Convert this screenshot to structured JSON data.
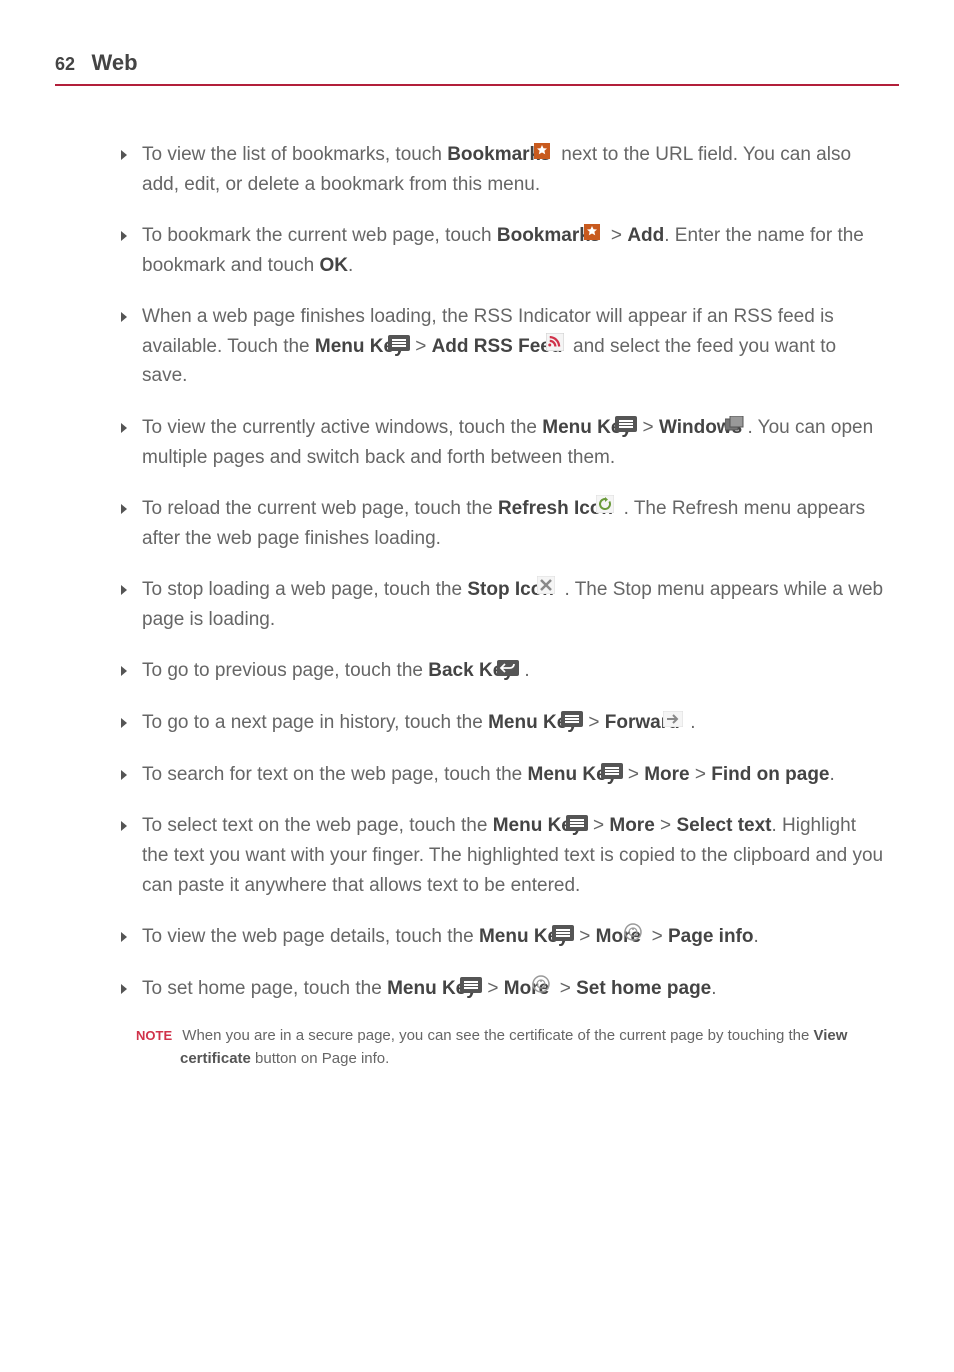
{
  "header": {
    "page_number": "62",
    "title": "Web"
  },
  "items": [
    {
      "parts": [
        {
          "t": "text",
          "v": "To view the list of bookmarks, touch "
        },
        {
          "t": "bold",
          "v": "Bookmarks"
        },
        {
          "t": "text",
          "v": " "
        },
        {
          "t": "icon",
          "v": "bookmark-star"
        },
        {
          "t": "text",
          "v": "  next to the URL field. You can also add, edit, or delete a bookmark from this menu."
        }
      ]
    },
    {
      "parts": [
        {
          "t": "text",
          "v": "To bookmark the current web page, touch "
        },
        {
          "t": "bold",
          "v": "Bookmarks"
        },
        {
          "t": "text",
          "v": " "
        },
        {
          "t": "icon",
          "v": "bookmark-star"
        },
        {
          "t": "text",
          "v": "  > "
        },
        {
          "t": "bold",
          "v": "Add"
        },
        {
          "t": "text",
          "v": ". Enter the name for the bookmark and touch "
        },
        {
          "t": "bold",
          "v": "OK"
        },
        {
          "t": "text",
          "v": "."
        }
      ]
    },
    {
      "parts": [
        {
          "t": "text",
          "v": "When a web page finishes loading, the RSS Indicator will appear if an RSS feed is available. Touch the "
        },
        {
          "t": "bold",
          "v": "Menu Key"
        },
        {
          "t": "text",
          "v": " "
        },
        {
          "t": "icon",
          "v": "menu-key"
        },
        {
          "t": "text",
          "v": " > "
        },
        {
          "t": "bold",
          "v": "Add RSS Feed"
        },
        {
          "t": "text",
          "v": " "
        },
        {
          "t": "icon",
          "v": "rss-feed"
        },
        {
          "t": "text",
          "v": " and select the feed you want to save."
        }
      ]
    },
    {
      "parts": [
        {
          "t": "text",
          "v": "To view the currently active windows, touch the "
        },
        {
          "t": "bold",
          "v": "Menu Key"
        },
        {
          "t": "text",
          "v": " "
        },
        {
          "t": "icon",
          "v": "menu-key"
        },
        {
          "t": "text",
          "v": " > "
        },
        {
          "t": "bold",
          "v": "Windows"
        },
        {
          "t": "text",
          "v": " "
        },
        {
          "t": "icon",
          "v": "windows"
        },
        {
          "t": "text",
          "v": ". You can open multiple pages and switch back and forth between them."
        }
      ]
    },
    {
      "parts": [
        {
          "t": "text",
          "v": "To reload the current web page, touch the "
        },
        {
          "t": "bold",
          "v": "Refresh Icon"
        },
        {
          "t": "text",
          "v": " "
        },
        {
          "t": "icon",
          "v": "refresh"
        },
        {
          "t": "text",
          "v": " . The Refresh menu appears after the web page finishes loading."
        }
      ]
    },
    {
      "parts": [
        {
          "t": "text",
          "v": "To stop loading a web page, touch the "
        },
        {
          "t": "bold",
          "v": "Stop Icon"
        },
        {
          "t": "text",
          "v": " "
        },
        {
          "t": "icon",
          "v": "stop"
        },
        {
          "t": "text",
          "v": " . The Stop menu appears while a web page is loading."
        }
      ]
    },
    {
      "parts": [
        {
          "t": "text",
          "v": "To go to previous page, touch the "
        },
        {
          "t": "bold",
          "v": "Back Key"
        },
        {
          "t": "text",
          "v": " "
        },
        {
          "t": "icon",
          "v": "back-key"
        },
        {
          "t": "text",
          "v": " ."
        }
      ]
    },
    {
      "parts": [
        {
          "t": "text",
          "v": "To go to a next page in history, touch the "
        },
        {
          "t": "bold",
          "v": "Menu Key"
        },
        {
          "t": "text",
          "v": " "
        },
        {
          "t": "icon",
          "v": "menu-key"
        },
        {
          "t": "text",
          "v": " > "
        },
        {
          "t": "bold",
          "v": "Forward"
        },
        {
          "t": "text",
          "v": " "
        },
        {
          "t": "icon",
          "v": "forward"
        },
        {
          "t": "text",
          "v": " ."
        }
      ]
    },
    {
      "parts": [
        {
          "t": "text",
          "v": "To search for text on the web page, touch the "
        },
        {
          "t": "bold",
          "v": "Menu Key"
        },
        {
          "t": "text",
          "v": " "
        },
        {
          "t": "icon",
          "v": "menu-key"
        },
        {
          "t": "text",
          "v": " > "
        },
        {
          "t": "bold",
          "v": "More"
        },
        {
          "t": "text",
          "v": " > "
        },
        {
          "t": "bold",
          "v": "Find on page"
        },
        {
          "t": "text",
          "v": "."
        }
      ]
    },
    {
      "parts": [
        {
          "t": "text",
          "v": "To select text on the web page, touch the "
        },
        {
          "t": "bold",
          "v": "Menu Key"
        },
        {
          "t": "text",
          "v": " "
        },
        {
          "t": "icon",
          "v": "menu-key"
        },
        {
          "t": "text",
          "v": " > "
        },
        {
          "t": "bold",
          "v": "More"
        },
        {
          "t": "text",
          "v": " > "
        },
        {
          "t": "bold",
          "v": "Select text"
        },
        {
          "t": "text",
          "v": ". Highlight the text you want with your finger. The highlighted text is copied to the clipboard and you can paste it anywhere that allows text to be entered."
        }
      ]
    },
    {
      "parts": [
        {
          "t": "text",
          "v": "To view the web page details, touch the "
        },
        {
          "t": "bold",
          "v": "Menu Key"
        },
        {
          "t": "text",
          "v": " "
        },
        {
          "t": "icon",
          "v": "menu-key"
        },
        {
          "t": "text",
          "v": " > "
        },
        {
          "t": "bold",
          "v": "More"
        },
        {
          "t": "text",
          "v": " "
        },
        {
          "t": "icon",
          "v": "more-circle"
        },
        {
          "t": "text",
          "v": " > "
        },
        {
          "t": "bold",
          "v": "Page info"
        },
        {
          "t": "text",
          "v": "."
        }
      ]
    },
    {
      "parts": [
        {
          "t": "text",
          "v": "To set home page, touch the "
        },
        {
          "t": "bold",
          "v": "Menu Key"
        },
        {
          "t": "text",
          "v": " "
        },
        {
          "t": "icon",
          "v": "menu-key"
        },
        {
          "t": "text",
          "v": " > "
        },
        {
          "t": "bold",
          "v": "More"
        },
        {
          "t": "text",
          "v": " "
        },
        {
          "t": "icon",
          "v": "more-circle"
        },
        {
          "t": "text",
          "v": " > "
        },
        {
          "t": "bold",
          "v": "Set home page"
        },
        {
          "t": "text",
          "v": "."
        }
      ]
    }
  ],
  "note": {
    "label": "NOTE",
    "text_before": "When you are in a secure page, you can see the certificate of the current page by touching the ",
    "bold": "View certificate",
    "text_after": " button on Page info."
  }
}
